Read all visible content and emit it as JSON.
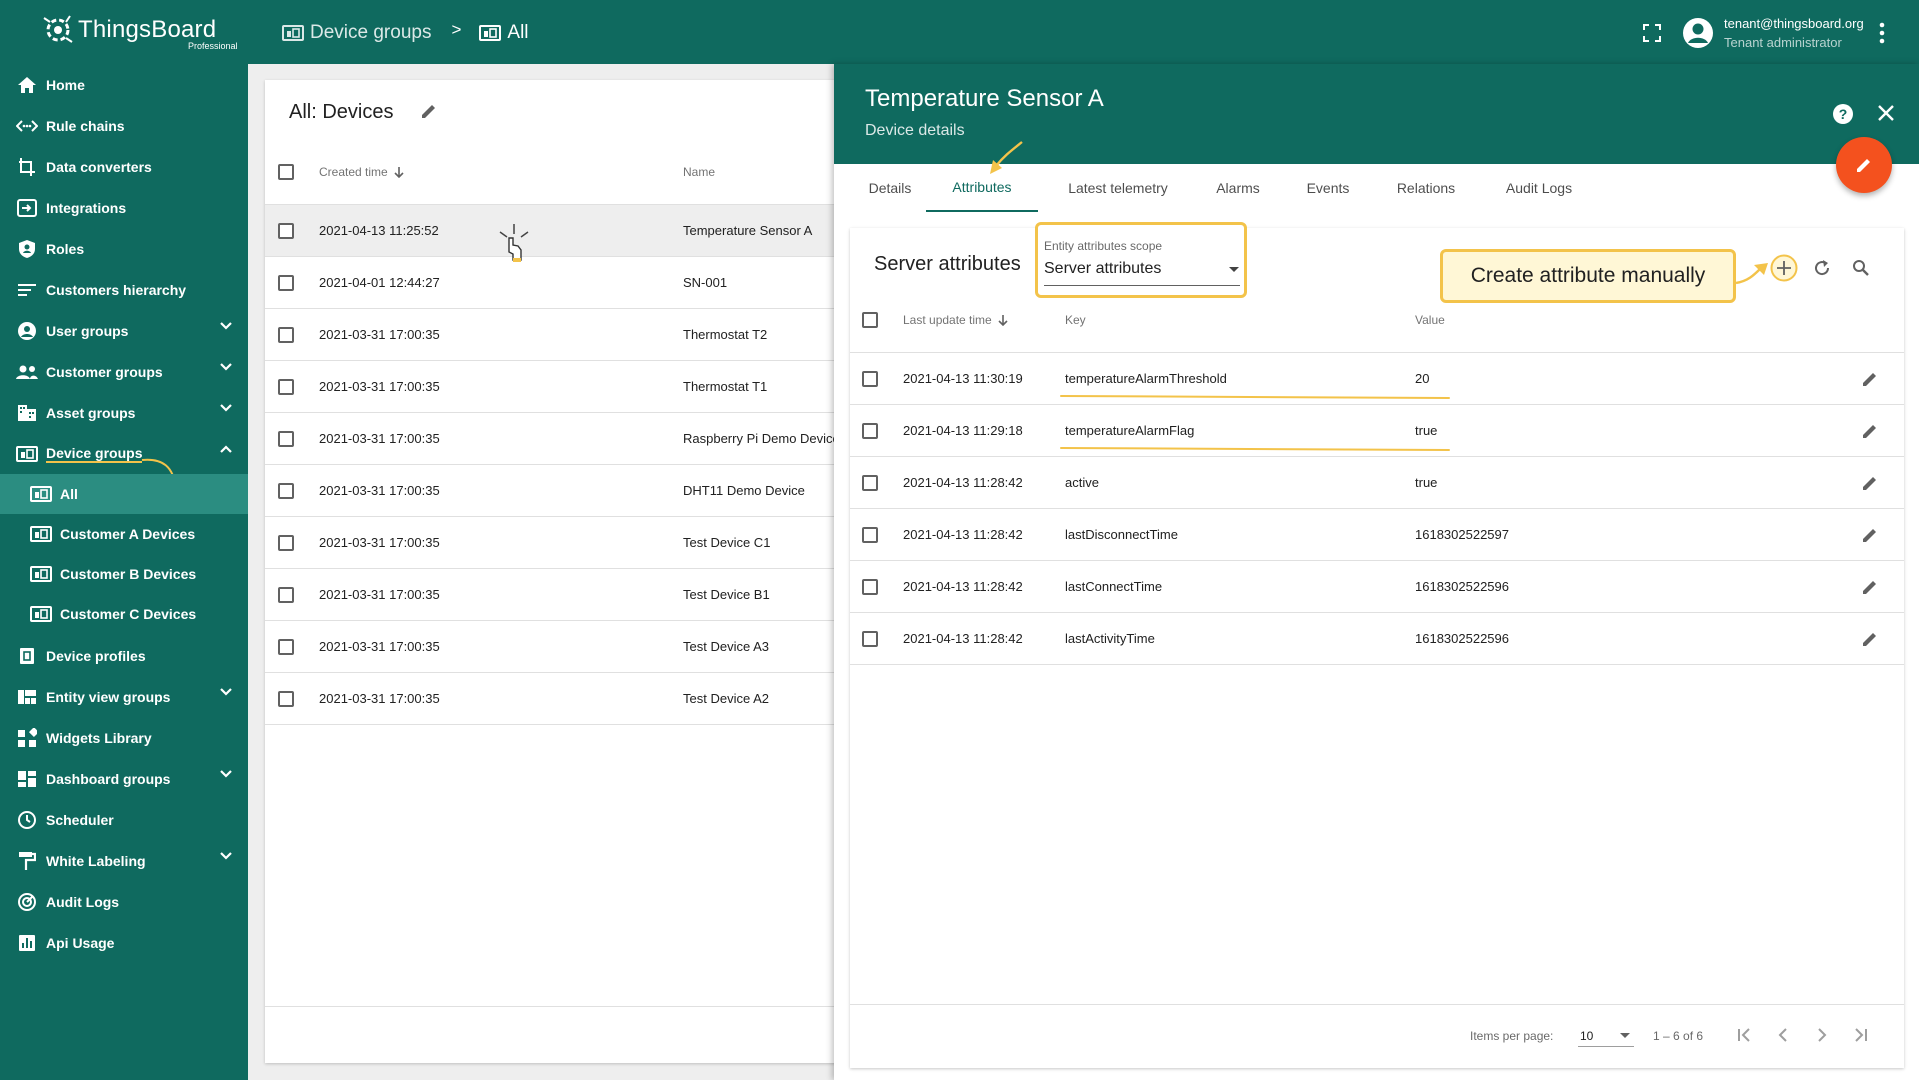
{
  "app": {
    "logo_name": "ThingsBoard",
    "logo_sub": "Professional",
    "accent": "#0f6a5f",
    "highlight": "#f3c34a",
    "fab_color": "#f4511e"
  },
  "breadcrumb": {
    "item1": "Device groups",
    "separator": ">",
    "item2": "All"
  },
  "user": {
    "email": "tenant@thingsboard.org",
    "role": "Tenant administrator"
  },
  "sidebar": {
    "home": "Home",
    "rule_chains": "Rule chains",
    "data_converters": "Data converters",
    "integrations": "Integrations",
    "roles": "Roles",
    "customers_hierarchy": "Customers hierarchy",
    "user_groups": "User groups",
    "customer_groups": "Customer groups",
    "asset_groups": "Asset groups",
    "device_groups": "Device groups",
    "all": "All",
    "customer_a": "Customer A Devices",
    "customer_b": "Customer B Devices",
    "customer_c": "Customer C Devices",
    "device_profiles": "Device profiles",
    "entity_view_groups": "Entity view groups",
    "widgets_library": "Widgets Library",
    "dashboard_groups": "Dashboard groups",
    "scheduler": "Scheduler",
    "white_labeling": "White Labeling",
    "audit_logs": "Audit Logs",
    "api_usage": "Api Usage"
  },
  "devices": {
    "title": "All: Devices",
    "col_created": "Created time",
    "col_name": "Name",
    "rows": [
      {
        "created": "2021-04-13 11:25:52",
        "name": "Temperature Sensor A"
      },
      {
        "created": "2021-04-01 12:44:27",
        "name": "SN-001"
      },
      {
        "created": "2021-03-31 17:00:35",
        "name": "Thermostat T2"
      },
      {
        "created": "2021-03-31 17:00:35",
        "name": "Thermostat T1"
      },
      {
        "created": "2021-03-31 17:00:35",
        "name": "Raspberry Pi Demo Device"
      },
      {
        "created": "2021-03-31 17:00:35",
        "name": "DHT11 Demo Device"
      },
      {
        "created": "2021-03-31 17:00:35",
        "name": "Test Device C1"
      },
      {
        "created": "2021-03-31 17:00:35",
        "name": "Test Device B1"
      },
      {
        "created": "2021-03-31 17:00:35",
        "name": "Test Device A3"
      },
      {
        "created": "2021-03-31 17:00:35",
        "name": "Test Device A2"
      }
    ]
  },
  "details": {
    "title": "Temperature Sensor A",
    "subtitle": "Device details",
    "tabs": {
      "details": "Details",
      "attributes": "Attributes",
      "latest_telemetry": "Latest telemetry",
      "alarms": "Alarms",
      "events": "Events",
      "relations": "Relations",
      "audit_logs": "Audit Logs"
    }
  },
  "attributes": {
    "title": "Server attributes",
    "scope_label": "Entity attributes scope",
    "scope_value": "Server attributes",
    "callout": "Create attribute manually",
    "col_time": "Last update time",
    "col_key": "Key",
    "col_value": "Value",
    "rows": [
      {
        "time": "2021-04-13 11:30:19",
        "key": "temperatureAlarmThreshold",
        "value": "20"
      },
      {
        "time": "2021-04-13 11:29:18",
        "key": "temperatureAlarmFlag",
        "value": "true"
      },
      {
        "time": "2021-04-13 11:28:42",
        "key": "active",
        "value": "true"
      },
      {
        "time": "2021-04-13 11:28:42",
        "key": "lastDisconnectTime",
        "value": "1618302522597"
      },
      {
        "time": "2021-04-13 11:28:42",
        "key": "lastConnectTime",
        "value": "1618302522596"
      },
      {
        "time": "2021-04-13 11:28:42",
        "key": "lastActivityTime",
        "value": "1618302522596"
      }
    ],
    "pager": {
      "items_label": "Items per page:",
      "items_value": "10",
      "range": "1 – 6 of 6"
    }
  }
}
